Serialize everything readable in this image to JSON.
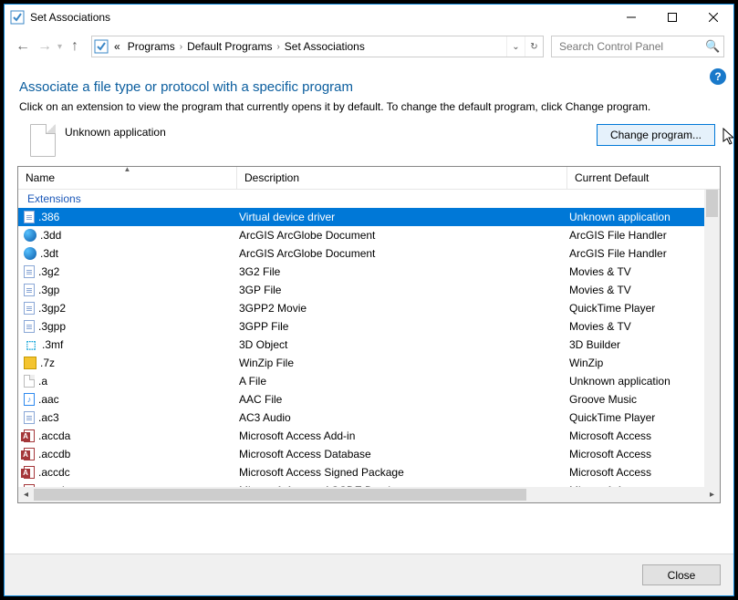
{
  "window": {
    "title": "Set Associations"
  },
  "nav": {
    "crumbs": [
      "Programs",
      "Default Programs",
      "Set Associations"
    ],
    "search_placeholder": "Search Control Panel"
  },
  "page": {
    "heading": "Associate a file type or protocol with a specific program",
    "subtext": "Click on an extension to view the program that currently opens it by default. To change the default program, click Change program.",
    "program_label": "Unknown application",
    "change_button": "Change program..."
  },
  "columns": {
    "name": "Name",
    "description": "Description",
    "default": "Current Default"
  },
  "group_header": "Extensions",
  "rows": [
    {
      "icon": "page",
      "ext": ".386",
      "desc": "Virtual device driver",
      "def": "Unknown application",
      "selected": true
    },
    {
      "icon": "globe",
      "ext": ".3dd",
      "desc": "ArcGIS ArcGlobe Document",
      "def": "ArcGIS File Handler"
    },
    {
      "icon": "globe",
      "ext": ".3dt",
      "desc": "ArcGIS ArcGlobe Document",
      "def": "ArcGIS File Handler"
    },
    {
      "icon": "page",
      "ext": ".3g2",
      "desc": "3G2 File",
      "def": "Movies & TV"
    },
    {
      "icon": "page",
      "ext": ".3gp",
      "desc": "3GP File",
      "def": "Movies & TV"
    },
    {
      "icon": "page",
      "ext": ".3gp2",
      "desc": "3GPP2 Movie",
      "def": "QuickTime Player"
    },
    {
      "icon": "page",
      "ext": ".3gpp",
      "desc": "3GPP File",
      "def": "Movies & TV"
    },
    {
      "icon": "threed",
      "ext": ".3mf",
      "desc": "3D Object",
      "def": "3D Builder"
    },
    {
      "icon": "zip",
      "ext": ".7z",
      "desc": "WinZip File",
      "def": "WinZip"
    },
    {
      "icon": "generic",
      "ext": ".a",
      "desc": "A File",
      "def": "Unknown application"
    },
    {
      "icon": "music",
      "ext": ".aac",
      "desc": "AAC File",
      "def": "Groove Music"
    },
    {
      "icon": "page",
      "ext": ".ac3",
      "desc": "AC3 Audio",
      "def": "QuickTime Player"
    },
    {
      "icon": "access",
      "ext": ".accda",
      "desc": "Microsoft Access Add-in",
      "def": "Microsoft Access"
    },
    {
      "icon": "access",
      "ext": ".accdb",
      "desc": "Microsoft Access Database",
      "def": "Microsoft Access"
    },
    {
      "icon": "access",
      "ext": ".accdc",
      "desc": "Microsoft Access Signed Package",
      "def": "Microsoft Access"
    },
    {
      "icon": "access",
      "ext": ".accde",
      "desc": "Microsoft Access ACCDE Database",
      "def": "Microsoft Access"
    }
  ],
  "footer": {
    "close": "Close"
  }
}
